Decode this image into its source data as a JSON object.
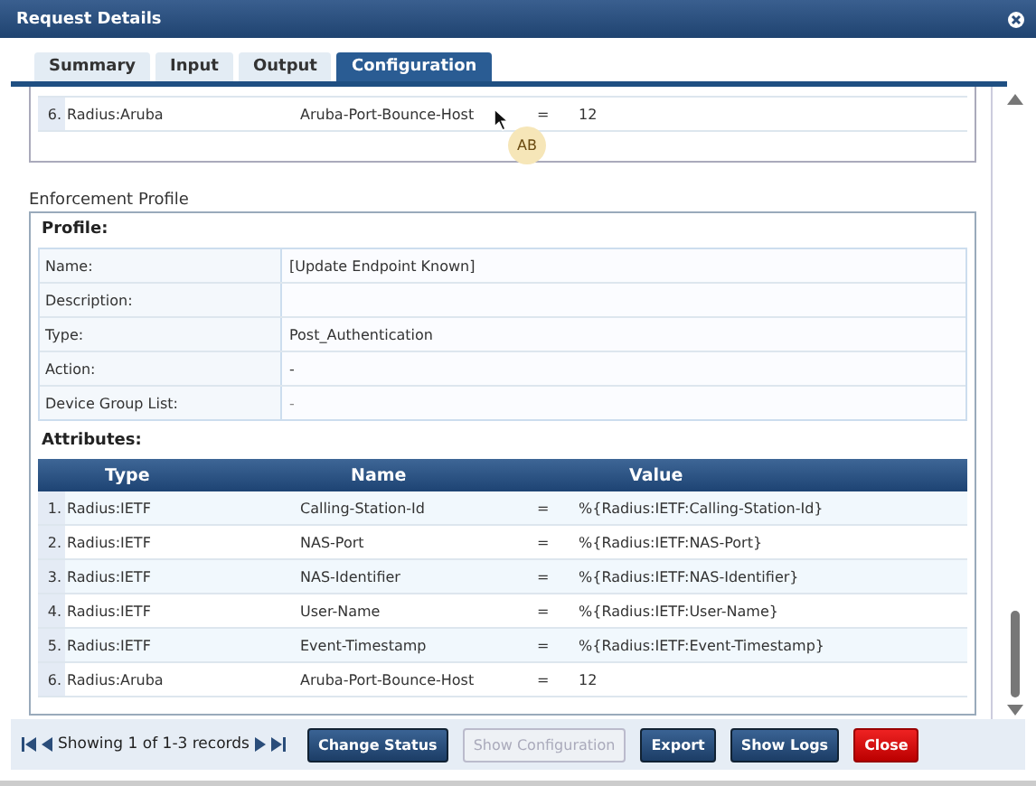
{
  "window": {
    "title": "Request Details"
  },
  "tabs": [
    {
      "label": "Summary",
      "selected": false
    },
    {
      "label": "Input",
      "selected": false
    },
    {
      "label": "Output",
      "selected": false
    },
    {
      "label": "Configuration",
      "selected": true
    }
  ],
  "top_partial_row": {
    "index": "6.",
    "type": "Radius:Aruba",
    "name": "Aruba-Port-Bounce-Host",
    "op": "=",
    "value": "12"
  },
  "cursor_badge": "AB",
  "enforcement_profile": {
    "title": "Enforcement Profile",
    "profile_heading": "Profile:",
    "fields": [
      {
        "label": "Name:",
        "value": "[Update Endpoint Known]"
      },
      {
        "label": "Description:"
      },
      {
        "label": "Type:",
        "value": "Post_Authentication"
      },
      {
        "label": "Action:",
        "value": "-"
      },
      {
        "label": "Device Group List:",
        "value": "-",
        "disabled": true
      }
    ],
    "attributes_heading": "Attributes:",
    "columns": [
      "Type",
      "Name",
      "Value"
    ],
    "rows": [
      {
        "index": "1.",
        "type": "Radius:IETF",
        "name": "Calling-Station-Id",
        "op": "=",
        "value": "%{Radius:IETF:Calling-Station-Id}"
      },
      {
        "index": "2.",
        "type": "Radius:IETF",
        "name": "NAS-Port",
        "op": "=",
        "value": "%{Radius:IETF:NAS-Port}"
      },
      {
        "index": "3.",
        "type": "Radius:IETF",
        "name": "NAS-Identifier",
        "op": "=",
        "value": "%{Radius:IETF:NAS-Identifier}"
      },
      {
        "index": "4.",
        "type": "Radius:IETF",
        "name": "User-Name",
        "op": "=",
        "value": "%{Radius:IETF:User-Name}"
      },
      {
        "index": "5.",
        "type": "Radius:IETF",
        "name": "Event-Timestamp",
        "op": "=",
        "value": "%{Radius:IETF:Event-Timestamp}"
      },
      {
        "index": "6.",
        "type": "Radius:Aruba",
        "name": "Aruba-Port-Bounce-Host",
        "op": "=",
        "value": "12"
      }
    ]
  },
  "footer": {
    "pager_text": "Showing 1 of 1-3 records",
    "buttons": [
      {
        "label": "Change Status",
        "kind": "primary",
        "disabled": false
      },
      {
        "label": "Show Configuration",
        "kind": "primary",
        "disabled": true
      },
      {
        "label": "Export",
        "kind": "primary",
        "disabled": false
      },
      {
        "label": "Show Logs",
        "kind": "primary",
        "disabled": false
      },
      {
        "label": "Close",
        "kind": "danger",
        "disabled": false
      }
    ]
  }
}
